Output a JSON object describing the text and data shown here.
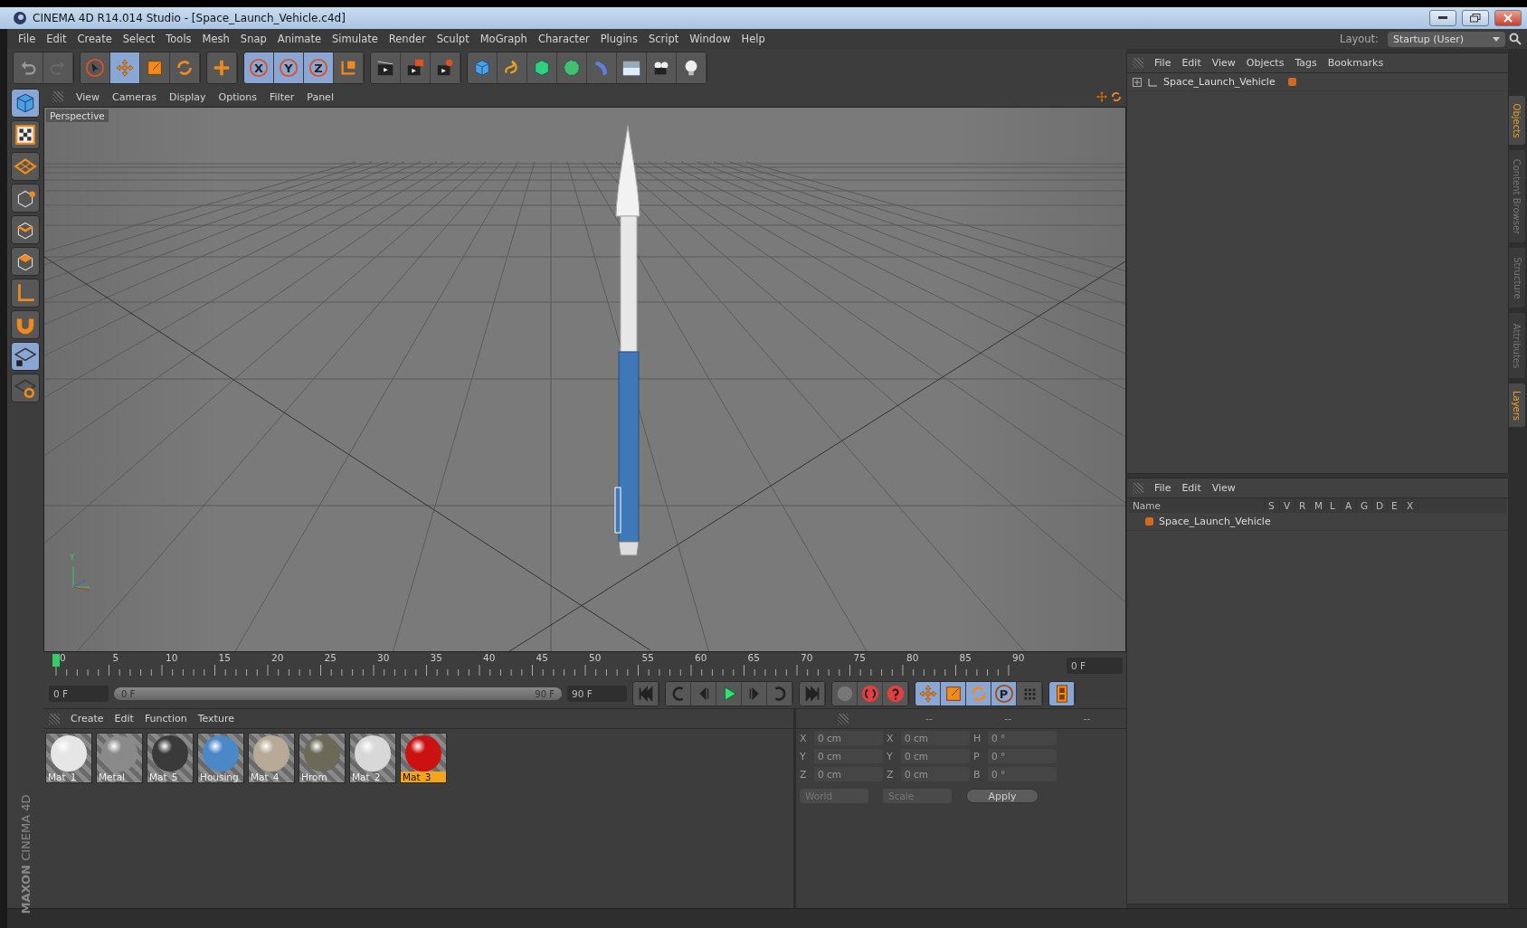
{
  "window": {
    "title": "CINEMA 4D R14.014 Studio - [Space_Launch_Vehicle.c4d]"
  },
  "menu": [
    "File",
    "Edit",
    "Create",
    "Select",
    "Tools",
    "Mesh",
    "Snap",
    "Animate",
    "Simulate",
    "Render",
    "Sculpt",
    "MoGraph",
    "Character",
    "Plugins",
    "Script",
    "Window",
    "Help"
  ],
  "layout": {
    "label": "Layout:",
    "value": "Startup (User)"
  },
  "toolbar": [
    {
      "tools": [
        {
          "kind": "undo",
          "active": false
        },
        {
          "kind": "redo",
          "active": false
        }
      ]
    },
    {
      "tools": [
        {
          "kind": "select",
          "active": false
        },
        {
          "kind": "move",
          "active": true
        },
        {
          "kind": "scale",
          "active": false
        },
        {
          "kind": "rotate",
          "active": false
        }
      ]
    },
    {
      "tools": [
        {
          "kind": "add",
          "active": false
        }
      ]
    },
    {
      "tools": [
        {
          "kind": "axis",
          "label": "X",
          "active": true
        },
        {
          "kind": "axis",
          "label": "Y",
          "active": true
        },
        {
          "kind": "axis",
          "label": "Z",
          "active": true
        },
        {
          "kind": "coords",
          "active": false
        }
      ]
    },
    {
      "tools": [
        {
          "kind": "render-view",
          "active": false
        },
        {
          "kind": "render-picture",
          "active": false
        },
        {
          "kind": "render-settings",
          "active": false
        }
      ]
    },
    {
      "tools": [
        {
          "kind": "cube",
          "active": false
        },
        {
          "kind": "spline",
          "active": false
        },
        {
          "kind": "nurbs",
          "active": false
        },
        {
          "kind": "array",
          "active": false
        },
        {
          "kind": "deformer",
          "active": false
        },
        {
          "kind": "floor",
          "active": false
        },
        {
          "kind": "camera",
          "active": false
        },
        {
          "kind": "light",
          "active": false
        }
      ]
    }
  ],
  "left_tools": [
    {
      "kind": "cube",
      "active": true
    },
    {
      "kind": "checker",
      "active": false
    },
    {
      "kind": "workplane",
      "active": false
    },
    {
      "kind": "points",
      "active": false
    },
    {
      "kind": "edges",
      "active": false
    },
    {
      "kind": "polygons",
      "active": false
    },
    {
      "kind": "axes",
      "active": false
    },
    {
      "kind": "magnet",
      "active": false
    },
    {
      "kind": "lockgrid",
      "active": true
    },
    {
      "kind": "gridrotate",
      "active": false
    }
  ],
  "logo": {
    "brand": "MAXON",
    "product": "CINEMA 4D"
  },
  "viewport": {
    "menu": [
      "View",
      "Cameras",
      "Display",
      "Options",
      "Filter",
      "Panel"
    ],
    "camera": "Perspective",
    "axis_labels": [
      "Y"
    ]
  },
  "timeline": {
    "ticks": [
      "0",
      "5",
      "10",
      "15",
      "20",
      "25",
      "30",
      "35",
      "40",
      "45",
      "50",
      "55",
      "60",
      "65",
      "70",
      "75",
      "80",
      "85",
      "90"
    ],
    "current": "0 F",
    "start": "0 F",
    "range_start": "0 F",
    "range_end": "90 F",
    "range": {
      "level": 1
    },
    "end": "90 F"
  },
  "transport": [
    {
      "tools": [
        {
          "kind": "go-start",
          "active": false
        }
      ]
    },
    {
      "tools": [
        {
          "kind": "prev-key",
          "active": false
        },
        {
          "kind": "step-back",
          "active": false
        },
        {
          "kind": "play",
          "active": false
        },
        {
          "kind": "step-forward",
          "active": false
        },
        {
          "kind": "next-key",
          "active": false
        }
      ]
    },
    {
      "tools": [
        {
          "kind": "go-end",
          "active": false
        }
      ]
    },
    {
      "tools": [
        {
          "kind": "key-off",
          "active": false
        },
        {
          "kind": "record",
          "active": false
        },
        {
          "kind": "help",
          "active": false
        }
      ]
    },
    {
      "tools": [
        {
          "kind": "move",
          "active": true
        },
        {
          "kind": "scale",
          "active": true
        },
        {
          "kind": "rotate",
          "active": true
        },
        {
          "kind": "param",
          "label": "P",
          "active": true
        },
        {
          "kind": "dots",
          "active": false
        }
      ]
    },
    {
      "tools": [
        {
          "kind": "film",
          "active": true
        }
      ]
    }
  ],
  "materials": {
    "menu": [
      "Create",
      "Edit",
      "Function",
      "Texture"
    ],
    "items": [
      {
        "name": "Mat_1",
        "color": "#e6e6e6",
        "selected": false
      },
      {
        "name": "Metal",
        "color": "#8a8a8a",
        "selected": false
      },
      {
        "name": "Mat_5",
        "color": "#3a3a3a",
        "selected": false
      },
      {
        "name": "Housing",
        "color": "#4a88c8",
        "selected": false
      },
      {
        "name": "Mat_4",
        "color": "#b9aa98",
        "selected": false
      },
      {
        "name": "Hrom",
        "color": "#6b6a58",
        "selected": false
      },
      {
        "name": "Mat_2",
        "color": "#d8d8d8",
        "selected": false
      },
      {
        "name": "Mat_3",
        "color": "#cc1111",
        "selected": true
      }
    ]
  },
  "coordinates": {
    "headers": [
      "--",
      "--",
      "--"
    ],
    "rows": [
      [
        {
          "label": "X",
          "value": "0 cm"
        },
        {
          "label": "X",
          "value": "0 cm"
        },
        {
          "label": "H",
          "value": "0 °"
        }
      ],
      [
        {
          "label": "Y",
          "value": "0 cm"
        },
        {
          "label": "Y",
          "value": "0 cm"
        },
        {
          "label": "P",
          "value": "0 °"
        }
      ],
      [
        {
          "label": "Z",
          "value": "0 cm"
        },
        {
          "label": "Z",
          "value": "0 cm"
        },
        {
          "label": "B",
          "value": "0 °"
        }
      ]
    ],
    "mode": "World",
    "type": "Scale",
    "apply": "Apply"
  },
  "objects": {
    "menu": [
      "File",
      "Edit",
      "View",
      "Objects",
      "Tags",
      "Bookmarks"
    ],
    "items": [
      {
        "name": "Space_Launch_Vehicle",
        "color": "#d2691e"
      }
    ]
  },
  "layers": {
    "menu": [
      "File",
      "Edit",
      "View"
    ],
    "columns": [
      "Name",
      "S",
      "V",
      "R",
      "M",
      "L",
      "A",
      "G",
      "D",
      "E",
      "X"
    ],
    "rows": [
      {
        "name": "Space_Launch_Vehicle",
        "color": "#d2691e"
      }
    ]
  },
  "side_tabs": [
    {
      "label": "Objects",
      "selected": true
    },
    {
      "label": "Content Browser",
      "selected": false
    },
    {
      "label": "Structure",
      "selected": false
    },
    {
      "label": "Attributes",
      "selected": false
    },
    {
      "label": "Layers",
      "selected": true
    }
  ]
}
